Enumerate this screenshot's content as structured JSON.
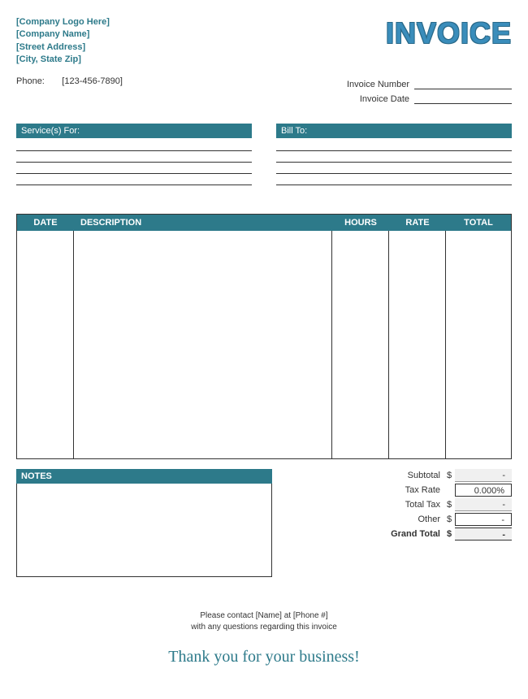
{
  "header": {
    "logo_placeholder": "[Company Logo Here]",
    "company_name": "[Company Name]",
    "street": "[Street Address]",
    "city_state_zip": "[City, State Zip]",
    "phone_label": "Phone:",
    "phone_value": "[123-456-7890]",
    "invoice_title": "INVOICE",
    "invoice_number_label": "Invoice Number",
    "invoice_date_label": "Invoice Date"
  },
  "sections": {
    "services_for": "Service(s) For:",
    "bill_to": "Bill To:"
  },
  "line_items": {
    "headers": {
      "date": "DATE",
      "description": "DESCRIPTION",
      "hours": "HOURS",
      "rate": "RATE",
      "total": "TOTAL"
    }
  },
  "notes": {
    "header": "NOTES"
  },
  "summary": {
    "subtotal_label": "Subtotal",
    "subtotal_cur": "$",
    "subtotal_val": "-",
    "taxrate_label": "Tax Rate",
    "taxrate_val": "0.000%",
    "totaltax_label": "Total Tax",
    "totaltax_cur": "$",
    "totaltax_val": "-",
    "other_label": "Other",
    "other_cur": "$",
    "other_val": "-",
    "grand_label": "Grand Total",
    "grand_cur": "$",
    "grand_val": "-"
  },
  "footer": {
    "contact_line1": "Please contact [Name] at [Phone #]",
    "contact_line2": "with any questions regarding this invoice",
    "thanks": "Thank you for your business!"
  }
}
